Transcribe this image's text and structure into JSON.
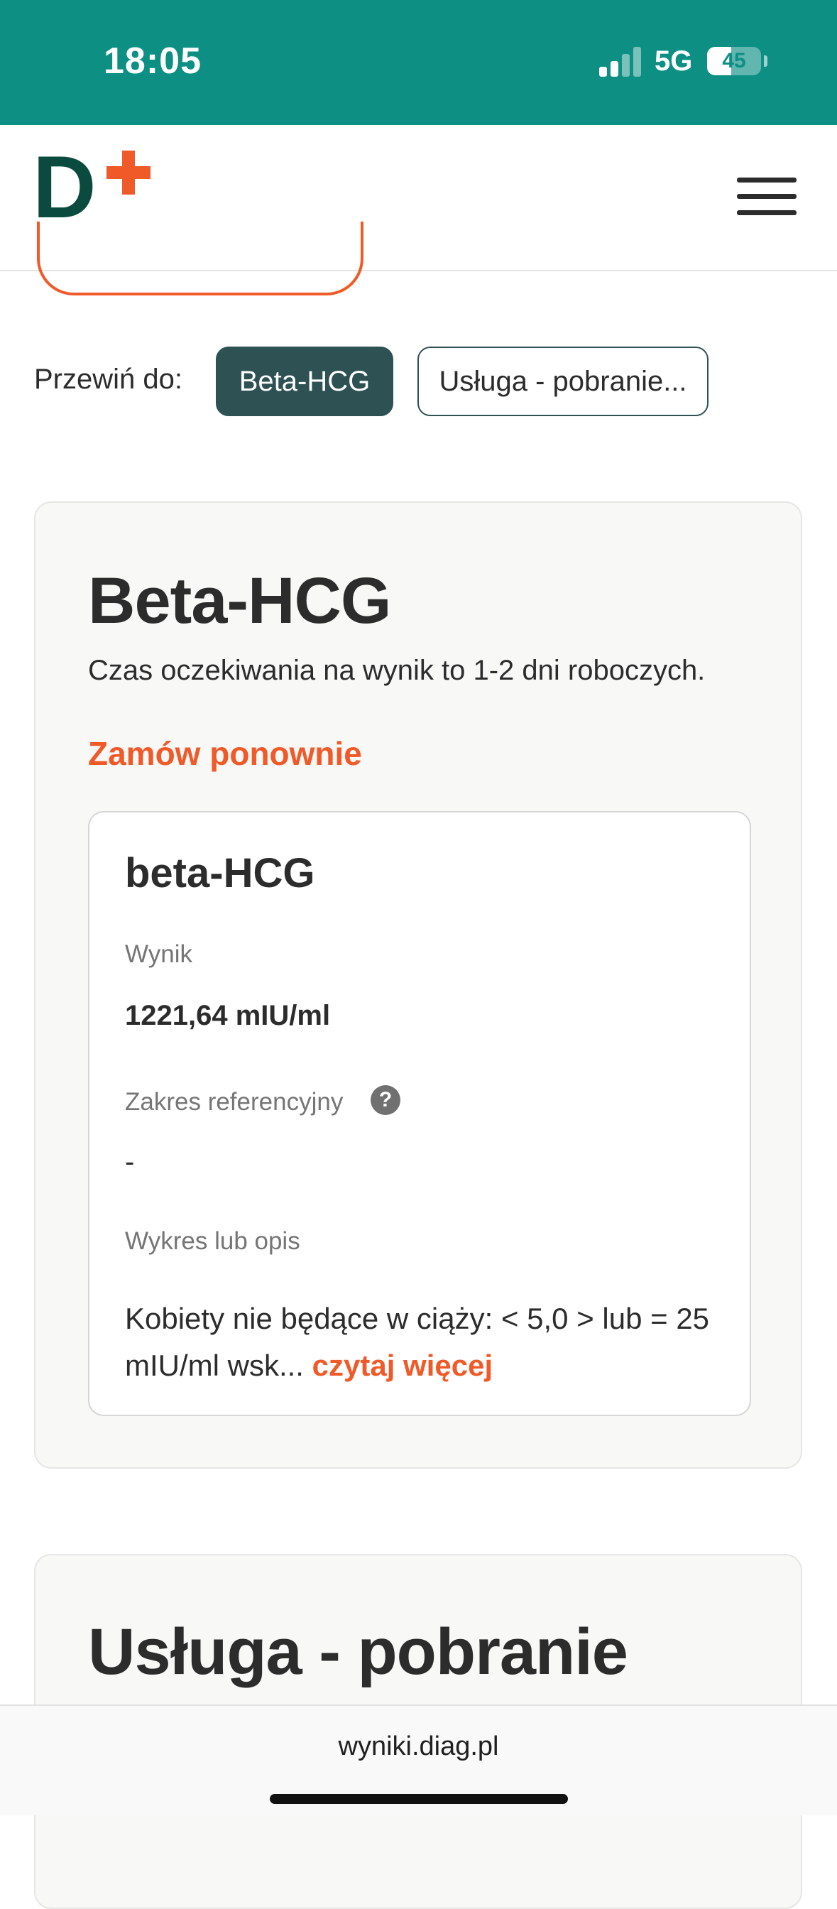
{
  "status_bar": {
    "time": "18:05",
    "network": "5G",
    "battery": "45",
    "battery_level": 0.45,
    "background_color": "#0d8f84"
  },
  "header": {
    "logo_letter": "D",
    "logo_mark": "plus-icon",
    "menu_icon": "hamburger-menu-icon",
    "brand_color": "#0b4a3f",
    "accent_color": "#f05a28"
  },
  "scroll_to": {
    "label": "Przewiń do:",
    "chips": [
      {
        "label": "Beta-HCG",
        "active": true
      },
      {
        "label": "Usługa - pobranie...",
        "active": false
      }
    ]
  },
  "test_card": {
    "title": "Beta-HCG",
    "wait_info": "Czas oczekiwania na wynik to 1-2 dni roboczych.",
    "reorder_label": "Zamów ponownie",
    "result": {
      "name": "beta-HCG",
      "result_label": "Wynik",
      "result_value": "1221,64 mIU/ml",
      "reference_label": "Zakres referencyjny",
      "reference_value": "-",
      "description_label": "Wykres lub opis",
      "description_text": "Kobiety nie będące w ciąży: < 5,0 > lub = 25 mIU/ml wsk...",
      "read_more_label": "czytaj więcej"
    }
  },
  "second_card": {
    "title": "Usługa - pobranie"
  },
  "browser": {
    "url": "wyniki.diag.pl"
  }
}
